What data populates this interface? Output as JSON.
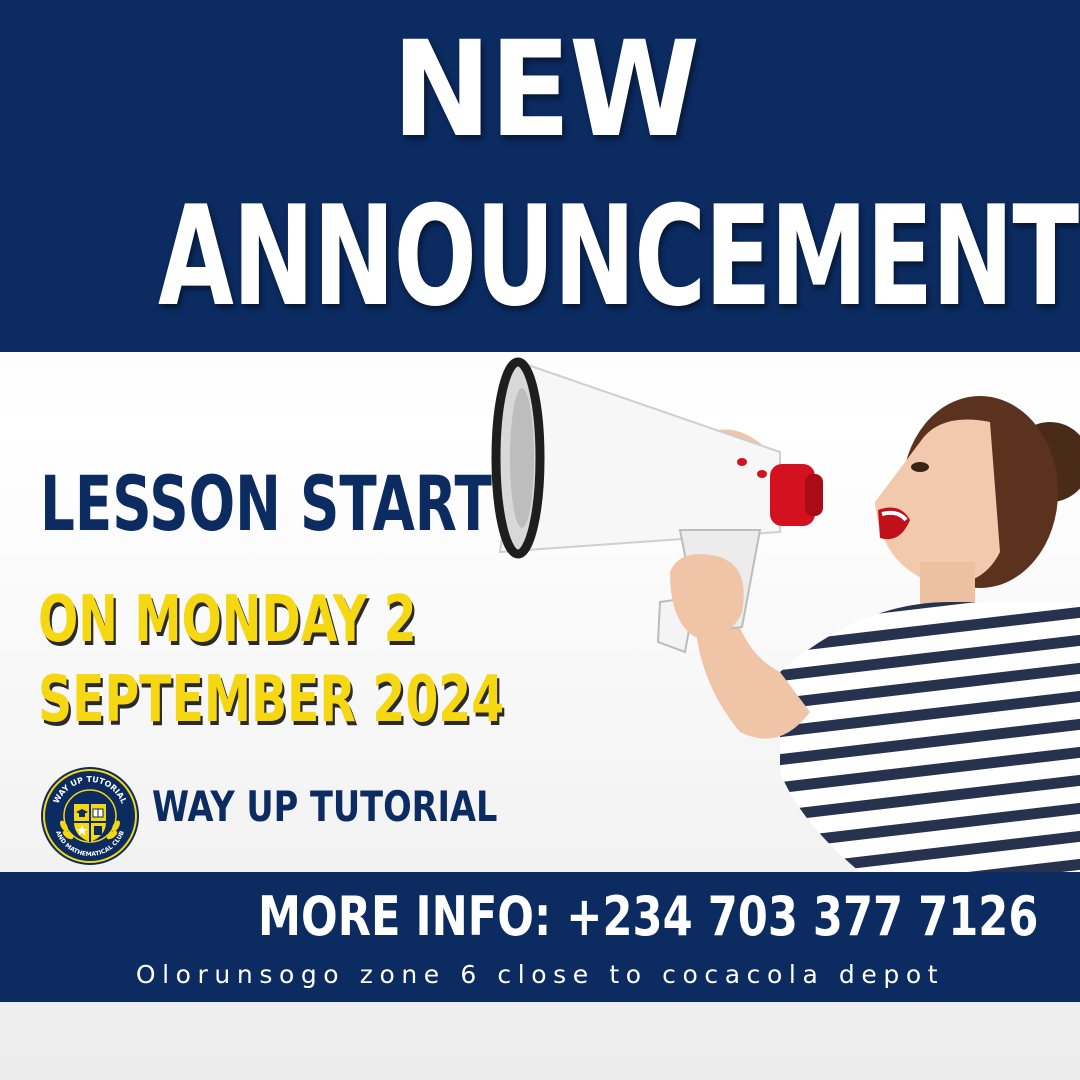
{
  "headline": {
    "line1": "NEW",
    "line2": "ANNOUNCEMENT"
  },
  "lesson": {
    "title": "LESSON START",
    "date_line1": "ON MONDAY 2",
    "date_line2": "SEPTEMBER 2024"
  },
  "brand": {
    "name": "WAY UP TUTORIAL",
    "logo_top_text": "WAY UP TUTORIAL",
    "logo_bottom_text": "AND MATHEMATICAL CLUB"
  },
  "contact": {
    "more_info": "MORE INFO: +234 703 377 7126",
    "address": "Olorunsogo zone 6 close to cocacola depot"
  },
  "colors": {
    "navy": "#0b2b61",
    "yellow": "#f6d812",
    "white": "#ffffff",
    "megaphone_red": "#d4111f"
  },
  "icons": [
    "megaphone-icon",
    "graduation-cap-icon",
    "book-icon",
    "star-icon",
    "laurel-icon"
  ]
}
